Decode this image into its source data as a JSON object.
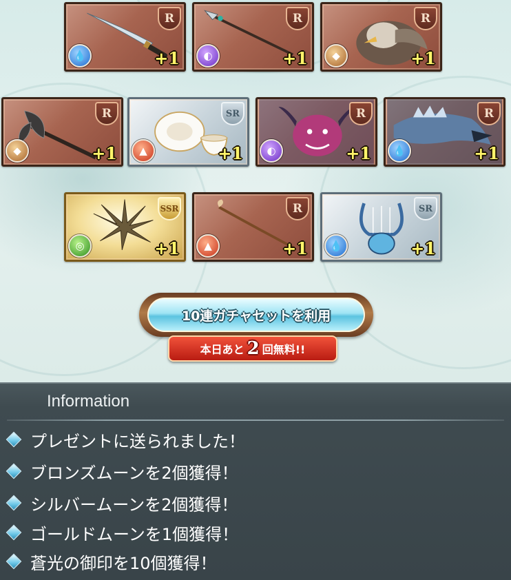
{
  "rewards": [
    {
      "rarity": "R",
      "element": "water",
      "qty": "+1",
      "item": "katana-weapon"
    },
    {
      "rarity": "R",
      "element": "dark",
      "qty": "+1",
      "item": "spear-weapon"
    },
    {
      "rarity": "R",
      "element": "earth",
      "qty": "+1",
      "item": "eagle-summon"
    },
    {
      "rarity": "R",
      "element": "earth",
      "qty": "+1",
      "item": "axe-weapon"
    },
    {
      "rarity": "SR",
      "element": "fire",
      "qty": "+1",
      "item": "teacup-summon"
    },
    {
      "rarity": "R",
      "element": "dark",
      "qty": "+1",
      "item": "demon-summon"
    },
    {
      "rarity": "R",
      "element": "water",
      "qty": "+1",
      "item": "dragon-summon"
    },
    {
      "rarity": "SSR",
      "element": "wind",
      "qty": "+1",
      "item": "claw-weapon"
    },
    {
      "rarity": "R",
      "element": "fire",
      "qty": "+1",
      "item": "staff-weapon"
    },
    {
      "rarity": "SR",
      "element": "water",
      "qty": "+1",
      "item": "harp-weapon"
    }
  ],
  "gacha_button": {
    "label": "10連ガチャセットを利用"
  },
  "free_banner": {
    "prefix": "本日あと",
    "count": "2",
    "suffix": "回無料!!"
  },
  "info": {
    "title": "Information",
    "lines": [
      "プレゼントに送られました！",
      "ブロンズムーンを2個獲得！",
      "シルバームーンを2個獲得！",
      "ゴールドムーンを1個獲得！",
      "蒼光の御印を10個獲得！"
    ]
  },
  "colors": {
    "info_bg": "#3f4b50",
    "qty_text": "#fff46a",
    "banner_red": "#d12a1b"
  }
}
